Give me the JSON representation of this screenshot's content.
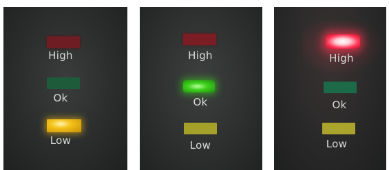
{
  "panels": [
    {
      "lit": "Low",
      "labels": {
        "high": "High",
        "ok": "Ok",
        "low": "Low"
      },
      "colors": {
        "high": "#6e1d22",
        "ok": "#1d5b3b",
        "low": "#f4c21a"
      }
    },
    {
      "lit": "Ok",
      "labels": {
        "high": "High",
        "ok": "Ok",
        "low": "Low"
      },
      "colors": {
        "high": "#7a1d24",
        "ok": "#3fd11c",
        "low": "#a4a12a"
      }
    },
    {
      "lit": "High",
      "labels": {
        "high": "High",
        "ok": "Ok",
        "low": "Low"
      },
      "colors": {
        "high": "#ff3355",
        "ok": "#1c6a48",
        "low": "#aaa42c"
      }
    }
  ]
}
